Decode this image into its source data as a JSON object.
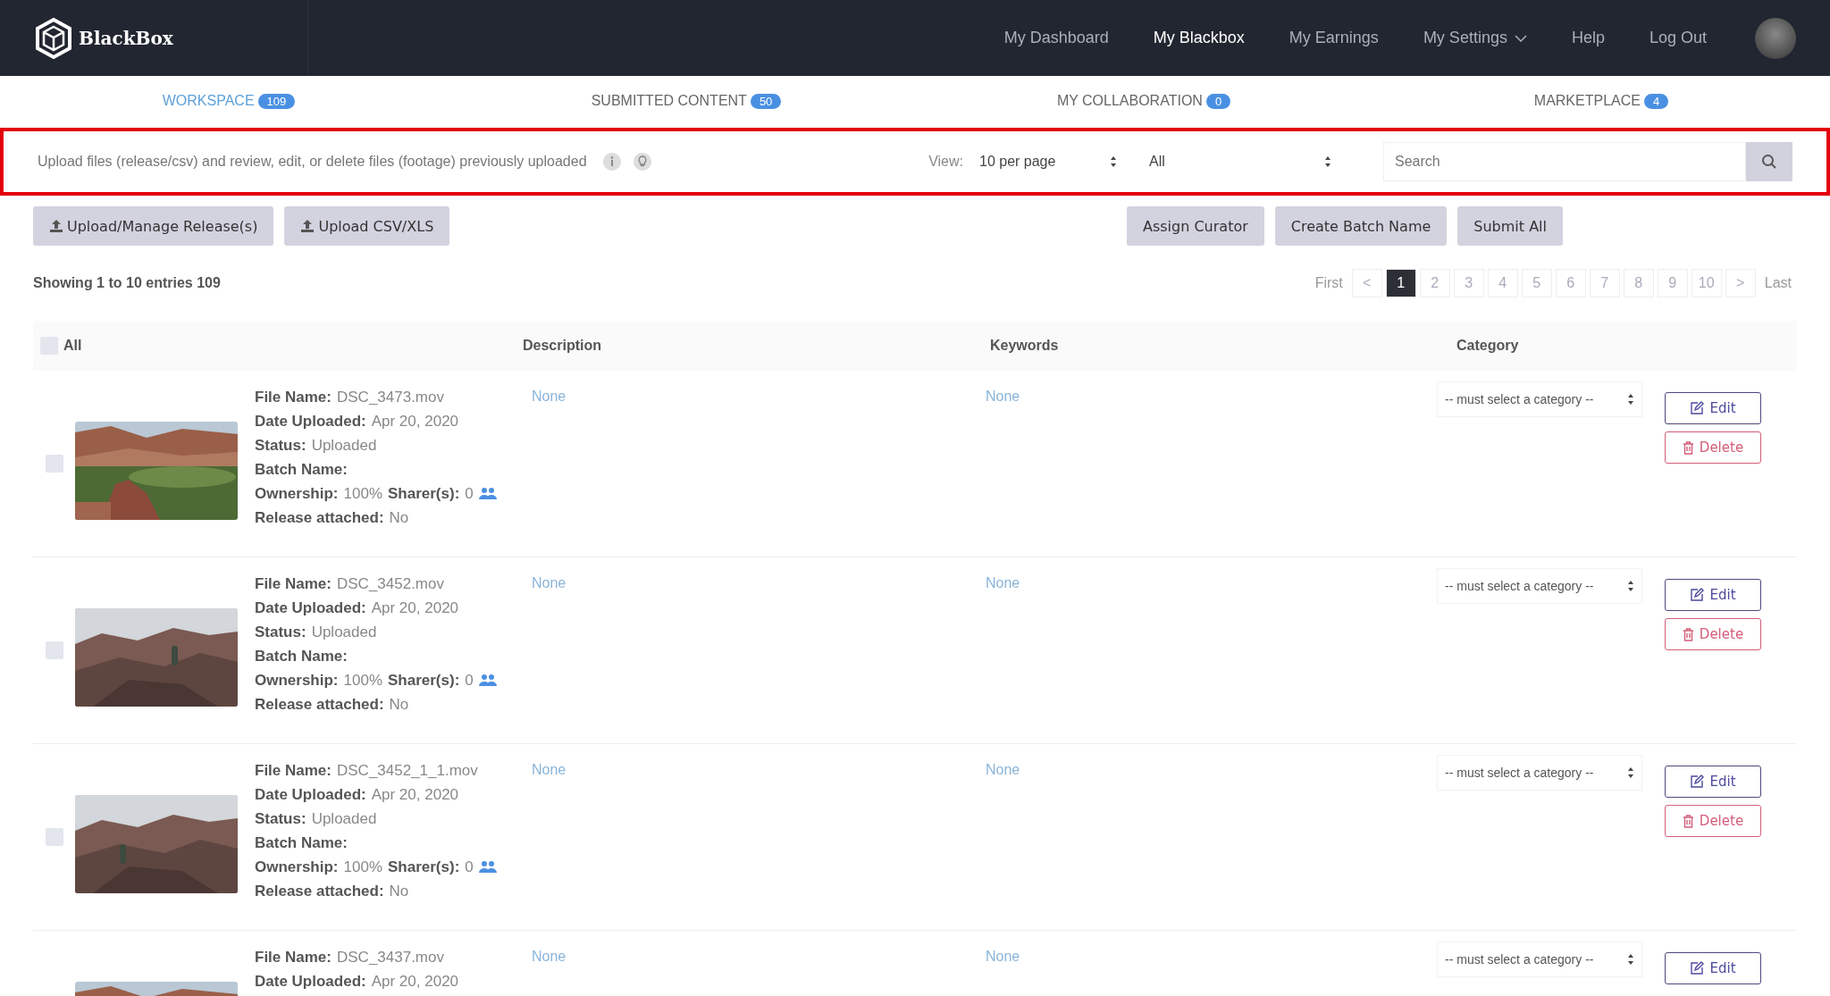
{
  "header": {
    "brand": "BlackBox",
    "nav": [
      {
        "label": "My Dashboard",
        "selected": false,
        "kind": "link"
      },
      {
        "label": "My Blackbox",
        "selected": true,
        "kind": "link"
      },
      {
        "label": "My Earnings",
        "selected": false,
        "kind": "link"
      },
      {
        "label": "My Settings",
        "selected": false,
        "kind": "dropdown"
      },
      {
        "label": "Help",
        "selected": false,
        "kind": "link"
      },
      {
        "label": "Log Out",
        "selected": false,
        "kind": "link"
      }
    ]
  },
  "tabs": [
    {
      "label": "WORKSPACE",
      "count": "109",
      "selected": true
    },
    {
      "label": "SUBMITTED CONTENT",
      "count": "50",
      "selected": false
    },
    {
      "label": "MY COLLABORATION",
      "count": "0",
      "selected": false
    },
    {
      "label": "MARKETPLACE",
      "count": "4",
      "selected": false
    }
  ],
  "toolbar": {
    "description": "Upload files (release/csv) and review, edit, or delete files (footage) previously uploaded",
    "view_label": "View:",
    "per_page": "10 per page",
    "filter": "All",
    "search": {
      "placeholder": "Search"
    }
  },
  "actions_left": [
    "Upload/Manage Release(s)",
    "Upload CSV/XLS"
  ],
  "actions_right": [
    "Assign Curator",
    "Create Batch Name",
    "Submit All"
  ],
  "summary": "Showing 1 to 10 entries 109",
  "pagination": [
    {
      "label": "First",
      "kind": "text",
      "selected": false
    },
    {
      "label": "<",
      "kind": "box",
      "selected": false
    },
    {
      "label": "1",
      "kind": "box",
      "selected": true
    },
    {
      "label": "2",
      "kind": "box",
      "selected": false
    },
    {
      "label": "3",
      "kind": "box",
      "selected": false
    },
    {
      "label": "4",
      "kind": "box",
      "selected": false
    },
    {
      "label": "5",
      "kind": "box",
      "selected": false
    },
    {
      "label": "6",
      "kind": "box",
      "selected": false
    },
    {
      "label": "7",
      "kind": "box",
      "selected": false
    },
    {
      "label": "8",
      "kind": "box",
      "selected": false
    },
    {
      "label": "9",
      "kind": "box",
      "selected": false
    },
    {
      "label": "10",
      "kind": "box",
      "selected": false
    },
    {
      "label": ">",
      "kind": "box",
      "selected": false
    },
    {
      "label": "Last",
      "kind": "text",
      "selected": false
    }
  ],
  "table": {
    "select_all": {
      "label": "All",
      "checked": false
    },
    "columns": [
      "Description",
      "Keywords",
      "Category"
    ],
    "rows": [
      {
        "checked": false,
        "fields": [
          {
            "kind": "text",
            "label": "File Name:",
            "value": "DSC_3473.mov"
          },
          {
            "kind": "text",
            "label": "Date Uploaded:",
            "value": "Apr 20, 2020"
          },
          {
            "kind": "text",
            "label": "Status:",
            "value": "Uploaded"
          },
          {
            "kind": "text",
            "label": "Batch Name:"
          },
          {
            "kind": "ownership",
            "label": "Ownership:",
            "value": "100%",
            "label2": "Sharer(s):",
            "value2": "0"
          },
          {
            "kind": "text",
            "label": "Release attached:",
            "value": "No"
          }
        ],
        "description": "None",
        "keywords": "None",
        "category": "-- must select a category --",
        "buttons": [
          {
            "kind": "edit",
            "label": "Edit"
          },
          {
            "kind": "delete",
            "label": "Delete"
          }
        ]
      },
      {
        "checked": false,
        "fields": [
          {
            "kind": "text",
            "label": "File Name:",
            "value": "DSC_3452.mov"
          },
          {
            "kind": "text",
            "label": "Date Uploaded:",
            "value": "Apr 20, 2020"
          },
          {
            "kind": "text",
            "label": "Status:",
            "value": "Uploaded"
          },
          {
            "kind": "text",
            "label": "Batch Name:"
          },
          {
            "kind": "ownership",
            "label": "Ownership:",
            "value": "100%",
            "label2": "Sharer(s):",
            "value2": "0"
          },
          {
            "kind": "text",
            "label": "Release attached:",
            "value": "No"
          }
        ],
        "description": "None",
        "keywords": "None",
        "category": "-- must select a category --",
        "buttons": [
          {
            "kind": "edit",
            "label": "Edit"
          },
          {
            "kind": "delete",
            "label": "Delete"
          }
        ]
      },
      {
        "checked": false,
        "fields": [
          {
            "kind": "text",
            "label": "File Name:",
            "value": "DSC_3452_1_1.mov"
          },
          {
            "kind": "text",
            "label": "Date Uploaded:",
            "value": "Apr 20, 2020"
          },
          {
            "kind": "text",
            "label": "Status:",
            "value": "Uploaded"
          },
          {
            "kind": "text",
            "label": "Batch Name:"
          },
          {
            "kind": "ownership",
            "label": "Ownership:",
            "value": "100%",
            "label2": "Sharer(s):",
            "value2": "0"
          },
          {
            "kind": "text",
            "label": "Release attached:",
            "value": "No"
          }
        ],
        "description": "None",
        "keywords": "None",
        "category": "-- must select a category --",
        "buttons": [
          {
            "kind": "edit",
            "label": "Edit"
          },
          {
            "kind": "delete",
            "label": "Delete"
          }
        ]
      },
      {
        "fields": [
          {
            "kind": "text",
            "label": "File Name:",
            "value": "DSC_3437.mov"
          },
          {
            "kind": "text",
            "label": "Date Uploaded:",
            "value": "Apr 20, 2020"
          }
        ],
        "description": "None",
        "keywords": "None",
        "category": "-- must select a category --",
        "buttons": [
          {
            "kind": "edit",
            "label": "Edit"
          }
        ]
      }
    ]
  }
}
